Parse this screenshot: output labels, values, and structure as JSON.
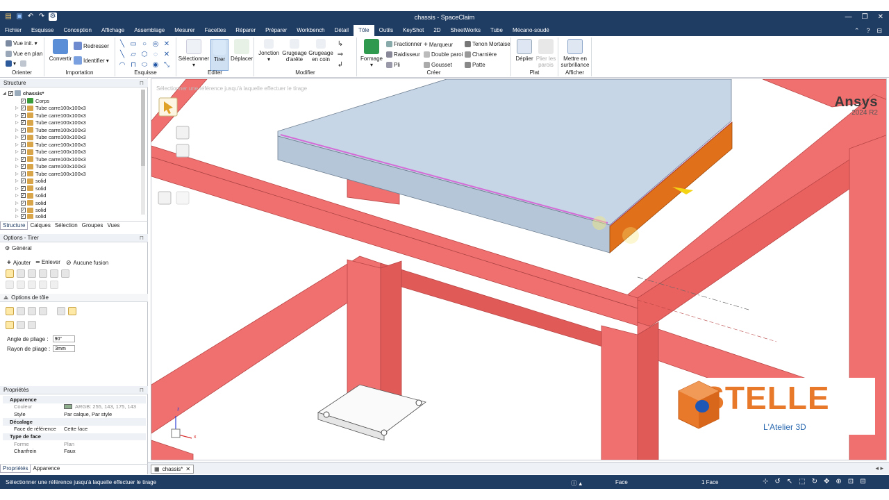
{
  "window": {
    "title": "chassis - SpaceClaim",
    "controls": [
      "—",
      "❐",
      "✕"
    ]
  },
  "menu": {
    "tabs": [
      "Fichier",
      "Esquisse",
      "Conception",
      "Affichage",
      "Assemblage",
      "Mesurer",
      "Facettes",
      "Réparer",
      "Préparer",
      "Workbench",
      "Détail",
      "Tôle",
      "Outils",
      "KeyShot",
      "2D",
      "SheetWorks",
      "Tube",
      "Mécano-soudé"
    ],
    "active": "Tôle"
  },
  "ribbon": {
    "orienter": {
      "label": "Orienter",
      "vue_init": "Vue init.",
      "vue_plan": "Vue en plan"
    },
    "importation": {
      "label": "Importation",
      "convertir": "Convertir",
      "redresser": "Redresser",
      "identifier": "Identifier"
    },
    "esquisse": {
      "label": "Esquisse"
    },
    "editer": {
      "label": "Editer",
      "selectionner": "Sélectionner",
      "tirer": "Tirer",
      "deplacer": "Déplacer"
    },
    "modifier": {
      "label": "Modifier",
      "jonction": "Jonction",
      "grugeage_arete": "Grugeage d'arête",
      "grugeage_coin": "Grugeage en coin"
    },
    "creer": {
      "label": "Créer",
      "formage": "Formage",
      "fractionner": "Fractionner",
      "marqueur": "Marqueur",
      "tenon": "Tenon Mortaise",
      "raidisseur": "Raidisseur",
      "double_paroi": "Double paroi",
      "charniere": "Charnière",
      "pli": "Pli",
      "gousset": "Gousset",
      "patte": "Patte"
    },
    "plat": {
      "label": "Plat",
      "deplier": "Déplier",
      "plier_parois": "Plier les parois"
    },
    "afficher": {
      "label": "Afficher",
      "mettre_surbrillance": "Mettre en surbrillance"
    }
  },
  "structure": {
    "title": "Structure",
    "root": "chassis*",
    "items": [
      "Corps",
      "Tube carre100x100x3",
      "Tube carre100x100x3",
      "Tube carre100x100x3",
      "Tube carre100x100x3",
      "Tube carre100x100x3",
      "Tube carre100x100x3",
      "Tube carre100x100x3",
      "Tube carre100x100x3",
      "Tube carre100x100x3",
      "Tube carre100x100x3",
      "solid",
      "solid",
      "solid",
      "solid",
      "solid",
      "solid"
    ],
    "tabs": [
      "Structure",
      "Calques",
      "Sélection",
      "Groupes",
      "Vues"
    ]
  },
  "options": {
    "title": "Options - Tirer",
    "general": "Général",
    "ajouter": "Ajouter",
    "enlever": "Enlever",
    "aucune_fusion": "Aucune fusion",
    "options_tole": "Options de tôle",
    "angle_label": "Angle de pliage :",
    "angle_value": "90°",
    "rayon_label": "Rayon de pliage :",
    "rayon_value": "3mm"
  },
  "properties": {
    "title": "Propriétés",
    "rows": [
      {
        "type": "cat",
        "k": "Apparence"
      },
      {
        "type": "grey",
        "k": "Couleur",
        "v": "ARGB: 255, 143, 175, 143",
        "swatch": "#8faf8f"
      },
      {
        "type": "row",
        "k": "Style",
        "v": "Par calque, Par style"
      },
      {
        "type": "cat",
        "k": "Décalage"
      },
      {
        "type": "row",
        "k": "Face de référence",
        "v": "Cette face"
      },
      {
        "type": "cat",
        "k": "Type de face"
      },
      {
        "type": "grey",
        "k": "Forme",
        "v": "Plan"
      },
      {
        "type": "row",
        "k": "Chanfrein",
        "v": "Faux"
      }
    ],
    "tabs": [
      "Propriétés",
      "Apparence"
    ]
  },
  "viewport": {
    "hint": "Sélectionner une référence jusqu'à laquelle effectuer le tirage",
    "ansys_name": "Ansys",
    "ansys_version": "2024 R2",
    "astelle_brand_a": "A",
    "astelle_brand_rest": "STELLE",
    "astelle_sub": "L'Atelier 3D",
    "axis_z": "z",
    "axis_x": "x"
  },
  "doc_tab": "chassis*",
  "status": {
    "message": "Sélectionner une référence jusqu'à laquelle effectuer le tirage",
    "selection_type": "Face",
    "count": "1 Face"
  },
  "colors": {
    "chrome": "#1f3c63",
    "frame": "#f0706f",
    "frame_dark": "#c84e4e",
    "plate": "#c6d6e6",
    "edge_orange": "#e0701a",
    "accent": "#e8782a"
  }
}
